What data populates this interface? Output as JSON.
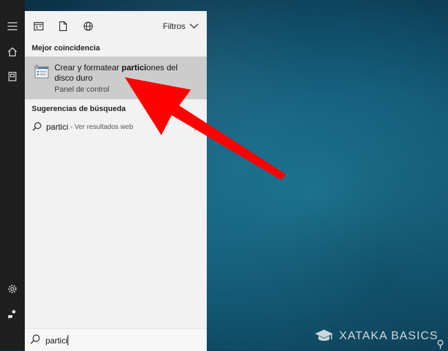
{
  "icons": {
    "menu": "hamburger-menu-icon",
    "home": "home-icon",
    "notebook": "notebook-icon",
    "settings": "gear-icon",
    "feedback": "feedback-icon",
    "apps": "apps-filter-icon",
    "documents": "document-filter-icon",
    "web": "globe-filter-icon",
    "filters": "chevron-down-icon",
    "search": "search-icon",
    "arrow": "chevron-right-icon"
  },
  "toolbar": {
    "filters_label": "Filtros"
  },
  "best_match": {
    "section_title": "Mejor coincidencia",
    "title_before": "Crear y formatear ",
    "title_bold": "partici",
    "title_after": "ones del disco duro",
    "subtitle": "Panel de control"
  },
  "suggestions": {
    "section_title": "Sugerencias de búsqueda",
    "items": [
      {
        "query": "partici",
        "hint": "- Ver resultados web"
      }
    ]
  },
  "search": {
    "value": "partici"
  },
  "watermark": {
    "text": "XATAKA BASICS"
  },
  "colors": {
    "rail": "#1f1f1f",
    "panel": "#f2f2f2",
    "selected_row": "#cccccc",
    "arrow": "#ff0000"
  }
}
